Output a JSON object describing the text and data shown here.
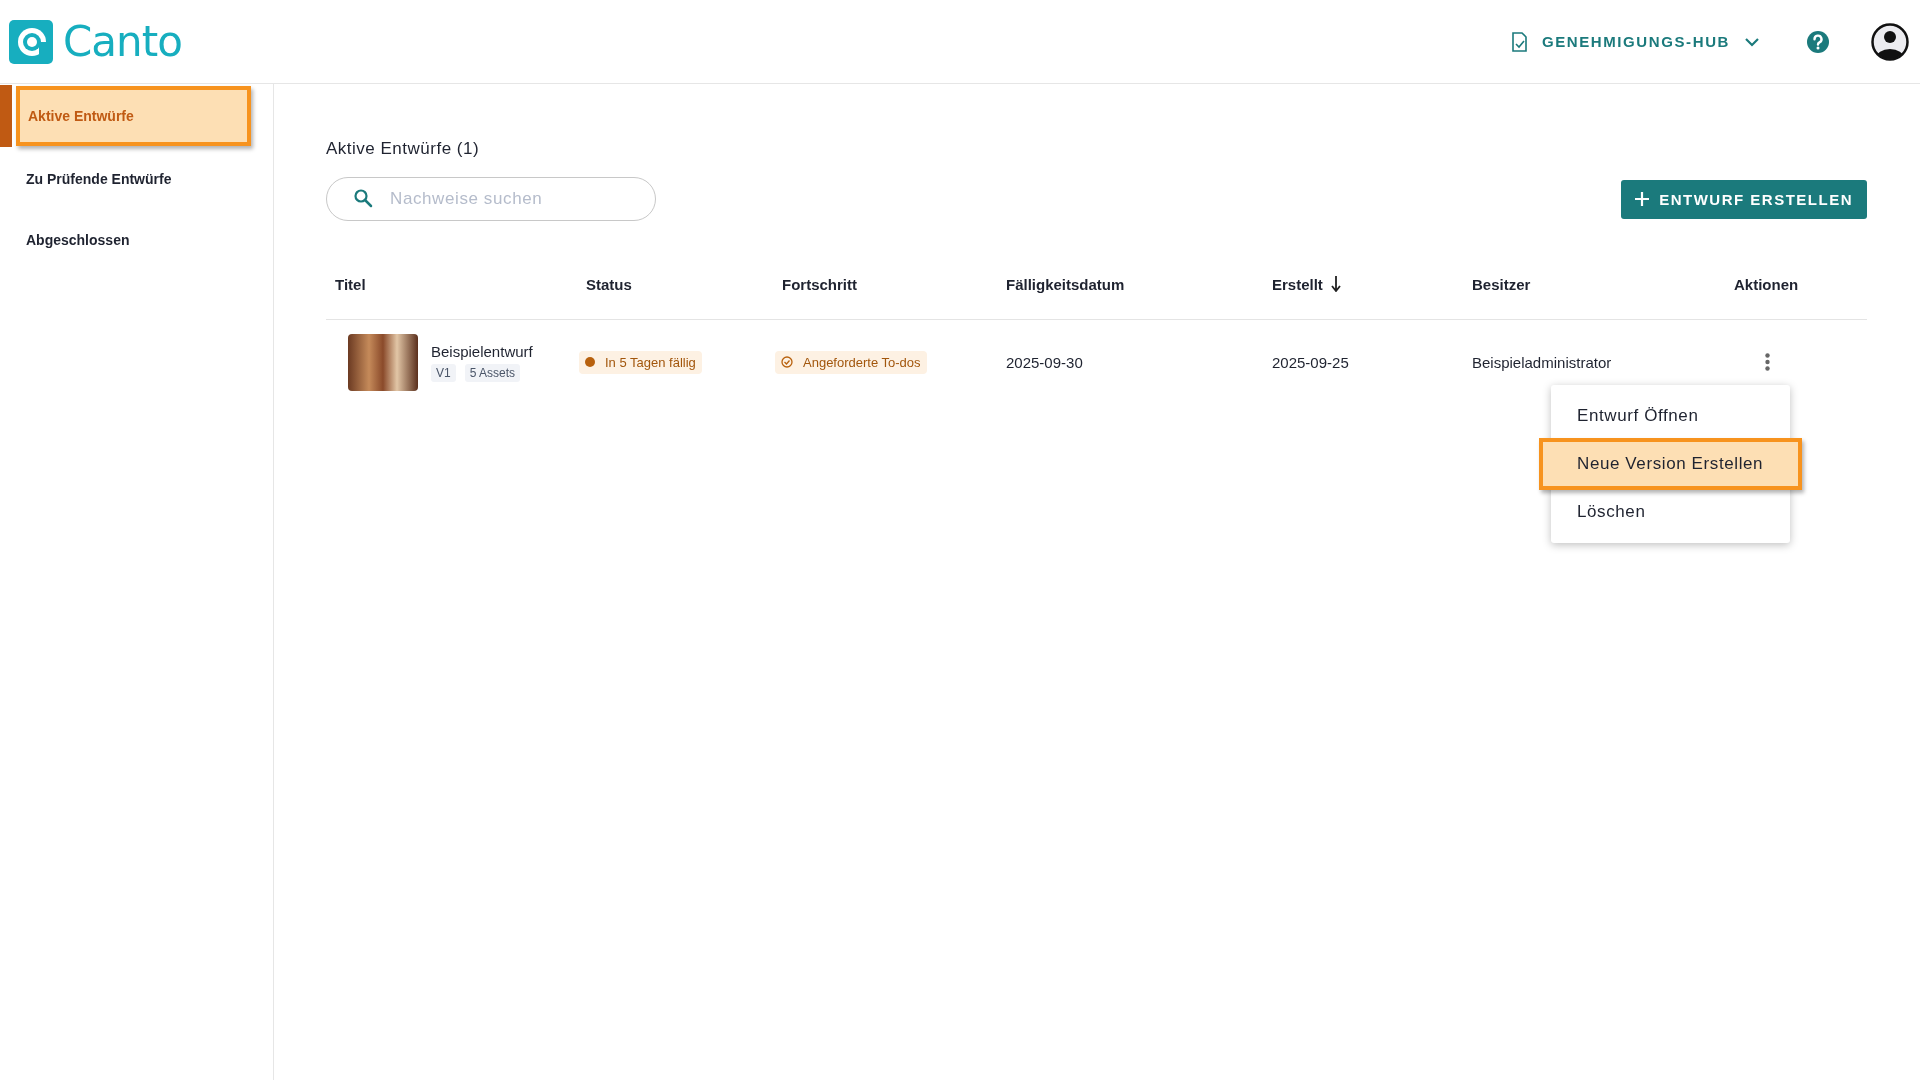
{
  "header": {
    "logo": "Canto",
    "hub_menu": "GENEHMIGUNGS-HUB"
  },
  "sidebar": {
    "items": [
      {
        "label": "Aktive Entwürfe",
        "selected": true
      },
      {
        "label": "Zu Prüfende Entwürfe",
        "selected": false
      },
      {
        "label": "Abgeschlossen",
        "selected": false
      }
    ]
  },
  "page_title": "Aktive Entwürfe (1)",
  "search": {
    "placeholder": "Nachweise suchen"
  },
  "create_button": "ENTWURF ERSTELLEN",
  "table": {
    "columns": [
      {
        "label": "Titel",
        "sorted": false
      },
      {
        "label": "Status",
        "sorted": false
      },
      {
        "label": "Fortschritt",
        "sorted": false
      },
      {
        "label": "Fälligkeitsdatum",
        "sorted": false
      },
      {
        "label": "Erstellt",
        "sorted": true
      },
      {
        "label": "Besitzer",
        "sorted": false
      },
      {
        "label": "Aktionen",
        "sorted": false
      }
    ],
    "rows": [
      {
        "title": "Beispielentwurf",
        "version": "V1",
        "assets": "5 Assets",
        "status": "In 5 Tagen fällig",
        "progress": "Angeforderte To-dos",
        "due": "2025-09-30",
        "created": "2025-09-25",
        "owner": "Beispieladministrator"
      }
    ]
  },
  "actions_menu": {
    "items": [
      {
        "label": "Entwurf Öffnen",
        "selected": false
      },
      {
        "label": "Neue Version Erstellen",
        "selected": true
      },
      {
        "label": "Löschen",
        "selected": false
      }
    ]
  }
}
